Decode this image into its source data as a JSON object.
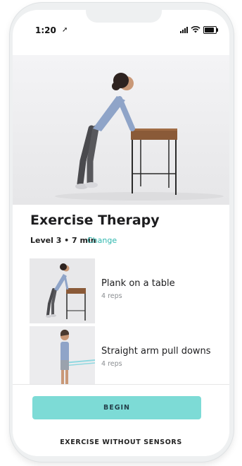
{
  "status_bar": {
    "time": "1:20",
    "location_icon": "navigation-arrow-icon",
    "signal_icon": "cellular-signal-icon",
    "wifi_icon": "wifi-icon",
    "battery_icon": "battery-icon"
  },
  "hero": {
    "image": "woman-doing-incline-plank-on-table"
  },
  "header": {
    "title": "Exercise Therapy",
    "meta": "Level 3 • 7 min",
    "change_label": "Change"
  },
  "exercises": [
    {
      "name": "Plank on a table",
      "reps": "4 reps",
      "thumb": "plank-on-table-thumbnail"
    },
    {
      "name": "Straight arm pull downs",
      "reps": "4 reps",
      "thumb": "straight-arm-pull-downs-thumbnail"
    }
  ],
  "actions": {
    "begin_label": "BEGIN",
    "without_sensors_label": "EXERCISE WITHOUT SENSORS"
  },
  "colors": {
    "accent": "#2fb7ae",
    "button": "#7ddbd6",
    "text": "#1d1d1f"
  }
}
